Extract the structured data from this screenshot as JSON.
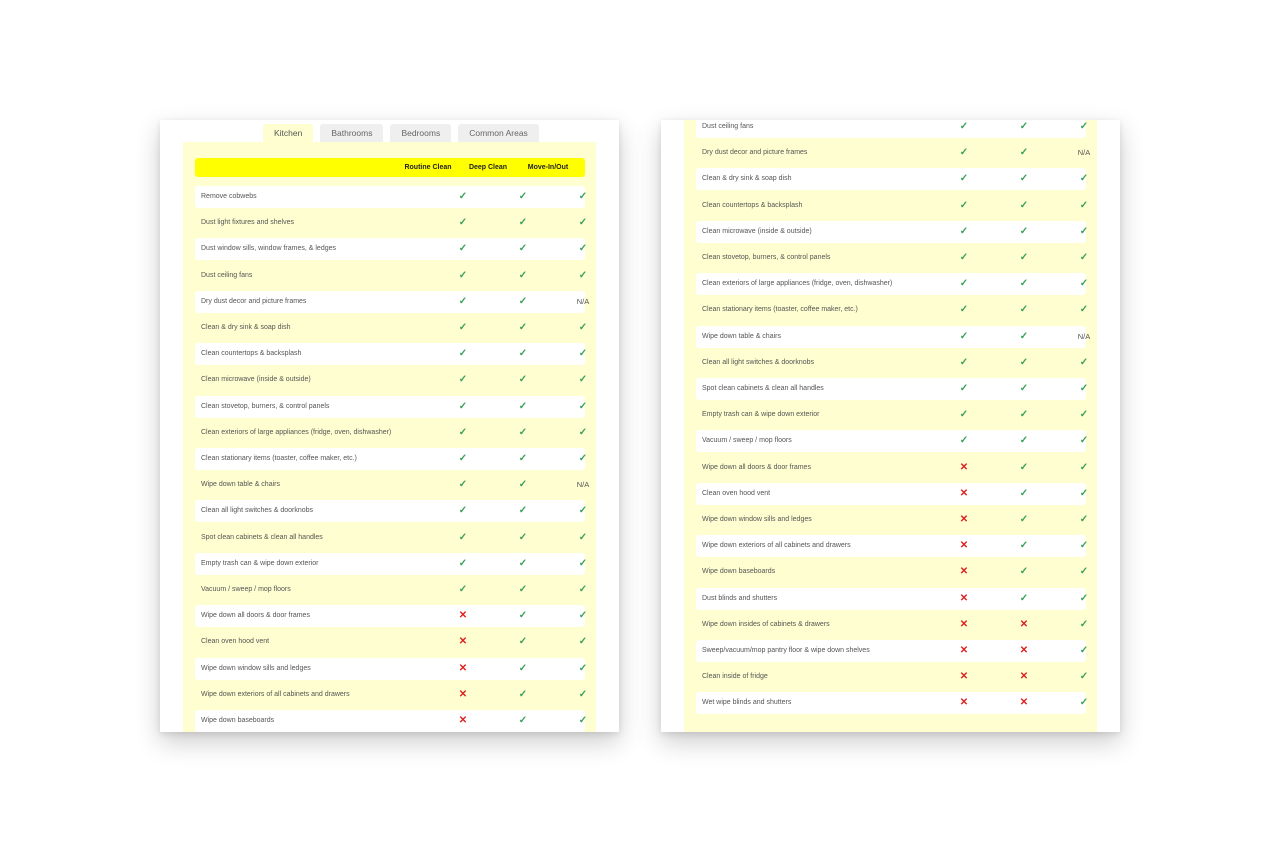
{
  "tabs": [
    "Kitchen",
    "Bathrooms",
    "Bedrooms",
    "Common Areas"
  ],
  "columns": [
    "Routine Clean",
    "Deep Clean",
    "Move-In/Out"
  ],
  "left_rows": [
    {
      "task": "Remove cobwebs",
      "values": [
        "yes",
        "yes",
        "yes"
      ]
    },
    {
      "task": "Dust light fixtures and shelves",
      "values": [
        "yes",
        "yes",
        "yes"
      ]
    },
    {
      "task": "Dust window sills, window frames, & ledges",
      "values": [
        "yes",
        "yes",
        "yes"
      ]
    },
    {
      "task": "Dust ceiling fans",
      "values": [
        "yes",
        "yes",
        "yes"
      ]
    },
    {
      "task": "Dry dust decor and picture frames",
      "values": [
        "yes",
        "yes",
        "N/A"
      ]
    },
    {
      "task": "Clean & dry sink & soap dish",
      "values": [
        "yes",
        "yes",
        "yes"
      ]
    },
    {
      "task": "Clean countertops & backsplash",
      "values": [
        "yes",
        "yes",
        "yes"
      ]
    },
    {
      "task": "Clean microwave (inside & outside)",
      "values": [
        "yes",
        "yes",
        "yes"
      ]
    },
    {
      "task": "Clean stovetop, burners, & control panels",
      "values": [
        "yes",
        "yes",
        "yes"
      ]
    },
    {
      "task": "Clean exteriors of large appliances (fridge, oven, dishwasher)",
      "values": [
        "yes",
        "yes",
        "yes"
      ]
    },
    {
      "task": "Clean stationary items (toaster, coffee maker, etc.)",
      "values": [
        "yes",
        "yes",
        "yes"
      ]
    },
    {
      "task": "Wipe down table & chairs",
      "values": [
        "yes",
        "yes",
        "N/A"
      ]
    },
    {
      "task": "Clean all light switches & doorknobs",
      "values": [
        "yes",
        "yes",
        "yes"
      ]
    },
    {
      "task": "Spot clean cabinets & clean all handles",
      "values": [
        "yes",
        "yes",
        "yes"
      ]
    },
    {
      "task": "Empty trash can & wipe down exterior",
      "values": [
        "yes",
        "yes",
        "yes"
      ]
    },
    {
      "task": "Vacuum / sweep / mop floors",
      "values": [
        "yes",
        "yes",
        "yes"
      ]
    },
    {
      "task": "Wipe down all doors & door frames",
      "values": [
        "no",
        "yes",
        "yes"
      ]
    },
    {
      "task": "Clean oven hood vent",
      "values": [
        "no",
        "yes",
        "yes"
      ]
    },
    {
      "task": "Wipe down window sills and ledges",
      "values": [
        "no",
        "yes",
        "yes"
      ]
    },
    {
      "task": "Wipe down exteriors of all cabinets and drawers",
      "values": [
        "no",
        "yes",
        "yes"
      ]
    },
    {
      "task": "Wipe down baseboards",
      "values": [
        "no",
        "yes",
        "yes"
      ]
    }
  ],
  "right_rows": [
    {
      "task": "Dust ceiling fans",
      "values": [
        "yes",
        "yes",
        "yes"
      ]
    },
    {
      "task": "Dry dust decor and picture frames",
      "values": [
        "yes",
        "yes",
        "N/A"
      ]
    },
    {
      "task": "Clean & dry sink & soap dish",
      "values": [
        "yes",
        "yes",
        "yes"
      ]
    },
    {
      "task": "Clean countertops & backsplash",
      "values": [
        "yes",
        "yes",
        "yes"
      ]
    },
    {
      "task": "Clean microwave (inside & outside)",
      "values": [
        "yes",
        "yes",
        "yes"
      ]
    },
    {
      "task": "Clean stovetop, burners, & control panels",
      "values": [
        "yes",
        "yes",
        "yes"
      ]
    },
    {
      "task": "Clean exteriors of large appliances (fridge, oven, dishwasher)",
      "values": [
        "yes",
        "yes",
        "yes"
      ]
    },
    {
      "task": "Clean stationary items (toaster, coffee maker, etc.)",
      "values": [
        "yes",
        "yes",
        "yes"
      ]
    },
    {
      "task": "Wipe down table & chairs",
      "values": [
        "yes",
        "yes",
        "N/A"
      ]
    },
    {
      "task": "Clean all light switches & doorknobs",
      "values": [
        "yes",
        "yes",
        "yes"
      ]
    },
    {
      "task": "Spot clean cabinets & clean all handles",
      "values": [
        "yes",
        "yes",
        "yes"
      ]
    },
    {
      "task": "Empty trash can & wipe down exterior",
      "values": [
        "yes",
        "yes",
        "yes"
      ]
    },
    {
      "task": "Vacuum / sweep / mop floors",
      "values": [
        "yes",
        "yes",
        "yes"
      ]
    },
    {
      "task": "Wipe down all doors & door frames",
      "values": [
        "no",
        "yes",
        "yes"
      ]
    },
    {
      "task": "Clean oven hood vent",
      "values": [
        "no",
        "yes",
        "yes"
      ]
    },
    {
      "task": "Wipe down window sills and ledges",
      "values": [
        "no",
        "yes",
        "yes"
      ]
    },
    {
      "task": "Wipe down exteriors of all cabinets and drawers",
      "values": [
        "no",
        "yes",
        "yes"
      ]
    },
    {
      "task": "Wipe down baseboards",
      "values": [
        "no",
        "yes",
        "yes"
      ]
    },
    {
      "task": "Dust blinds and shutters",
      "values": [
        "no",
        "yes",
        "yes"
      ]
    },
    {
      "task": "Wipe down insides of cabinets & drawers",
      "values": [
        "no",
        "no",
        "yes"
      ]
    },
    {
      "task": "Sweep/vacuum/mop pantry floor & wipe down shelves",
      "values": [
        "no",
        "no",
        "yes"
      ]
    },
    {
      "task": "Clean inside of fridge",
      "values": [
        "no",
        "no",
        "yes"
      ]
    },
    {
      "task": "Wet wipe blinds and shutters",
      "values": [
        "no",
        "no",
        "yes"
      ]
    }
  ],
  "icons": {
    "yes": "checkmark-icon",
    "no": "cross-icon"
  },
  "colors": {
    "header": "#ffff00",
    "panel": "#fefed0",
    "check": "#3aa05a",
    "cross": "#e02020"
  }
}
